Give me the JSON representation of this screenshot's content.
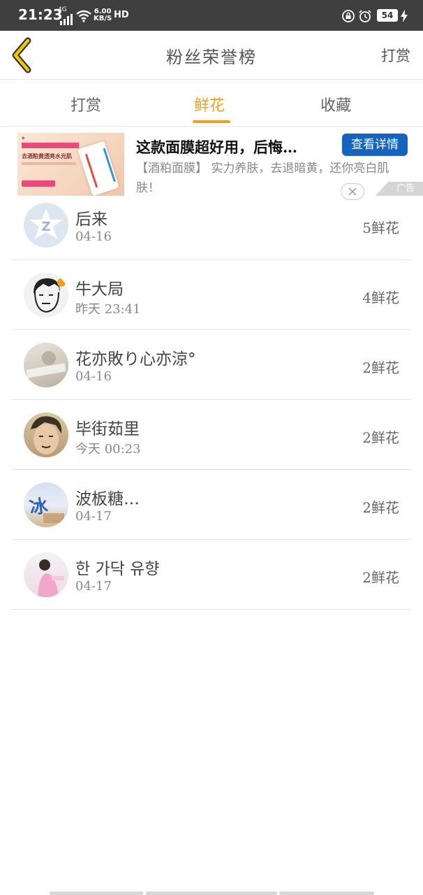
{
  "status_bar": {
    "time": "21:23",
    "network": "4G",
    "speed_value": "6.00",
    "speed_unit": "KB/S",
    "hd": "HD",
    "battery": "54"
  },
  "header": {
    "title": "粉丝荣誉榜",
    "right_action": "打赏"
  },
  "tabs": [
    {
      "label": "打赏",
      "active": false
    },
    {
      "label": "鲜花",
      "active": true
    },
    {
      "label": "收藏",
      "active": false
    }
  ],
  "ad": {
    "title": "这款面膜超好用，后悔…",
    "cta": "查看详情",
    "description": "【酒粕面膜】 实力养肤，去退暗黄，还你亮白肌肤！",
    "image_text": "去酒粕黄透亮水光肌",
    "label": "广告"
  },
  "fans": [
    {
      "name": "后来",
      "time": "04-16",
      "count": "5鲜花"
    },
    {
      "name": "牛大局",
      "time": "昨天 23:41",
      "count": "4鲜花"
    },
    {
      "name": "花亦敗り心亦涼°",
      "time": "04-16",
      "count": "2鲜花"
    },
    {
      "name": "毕街茹里",
      "time": "今天 00:23",
      "count": "2鲜花"
    },
    {
      "name": "波板糖…",
      "time": "04-17",
      "count": "2鲜花"
    },
    {
      "name": "한 가닥 유향",
      "time": "04-17",
      "count": "2鲜花"
    }
  ],
  "colors": {
    "accent": "#f0a020",
    "cta": "#1565c0",
    "statusbar": "#3f3f3f"
  }
}
